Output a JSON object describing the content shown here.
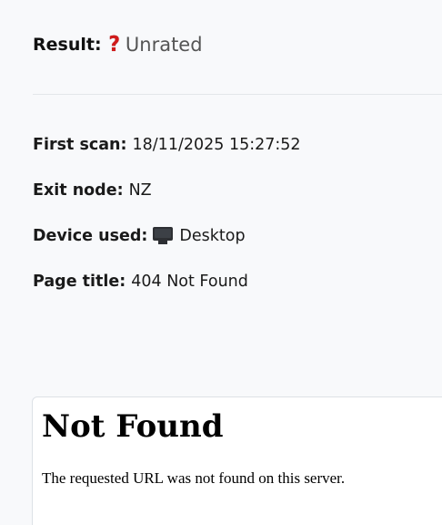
{
  "result": {
    "label": "Result:",
    "icon": "question-mark-icon",
    "icon_glyph": "❓",
    "value": "Unrated"
  },
  "details": {
    "first_scan": {
      "label": "First scan:",
      "value": "18/11/2025 15:27:52"
    },
    "exit_node": {
      "label": "Exit node:",
      "value": "NZ"
    },
    "device_used": {
      "label": "Device used:",
      "icon": "desktop-monitor-icon",
      "value": "Desktop"
    },
    "page_title": {
      "label": "Page title:",
      "value": "404 Not Found"
    }
  },
  "preview": {
    "heading": "Not Found",
    "message": "The requested URL was not found on this server."
  }
}
